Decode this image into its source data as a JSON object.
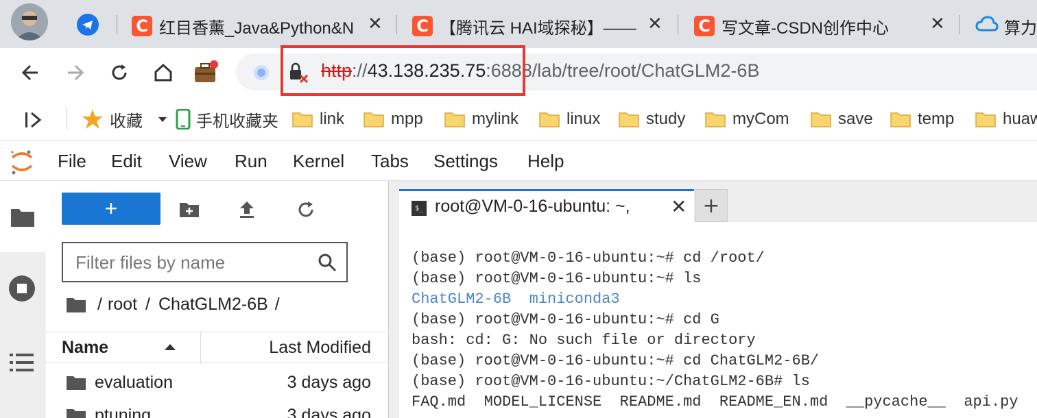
{
  "browser": {
    "tabs": [
      {
        "favicon": "C",
        "title": "红目香薰_Java&Python&N"
      },
      {
        "favicon": "C",
        "title": "【腾讯云 HAI域探秘】——"
      },
      {
        "favicon": "C",
        "title": "写文章-CSDN创作中心"
      },
      {
        "favicon": "cloud-icon",
        "title": "算力"
      }
    ],
    "tab_close_glyph": "✕",
    "url": {
      "scheme": "http",
      "separator": "://",
      "host": "43.138.235.75",
      "rest": ":6888/lab/tree/root/ChatGLM2-6B"
    },
    "bookmarks": [
      {
        "label": "收藏",
        "icon": "star-icon"
      },
      {
        "label": "手机收藏夹",
        "icon": "phone-icon"
      },
      {
        "label": "link",
        "icon": "folder-icon"
      },
      {
        "label": "mpp",
        "icon": "folder-icon"
      },
      {
        "label": "mylink",
        "icon": "folder-icon"
      },
      {
        "label": "linux",
        "icon": "folder-icon"
      },
      {
        "label": "study",
        "icon": "folder-icon"
      },
      {
        "label": "myCom",
        "icon": "folder-icon"
      },
      {
        "label": "save",
        "icon": "folder-icon"
      },
      {
        "label": "temp",
        "icon": "folder-icon"
      },
      {
        "label": "huaw",
        "icon": "folder-icon"
      }
    ]
  },
  "jupyter": {
    "menu": [
      "File",
      "Edit",
      "View",
      "Run",
      "Kernel",
      "Tabs",
      "Settings",
      "Help"
    ],
    "new_button": "+",
    "filter_placeholder": "Filter files by name",
    "breadcrumbs": [
      "/",
      "root",
      "/",
      "ChatGLM2-6B",
      "/"
    ],
    "columns": {
      "name": "Name",
      "modified": "Last Modified"
    },
    "files": [
      {
        "name": "evaluation",
        "modified": "3 days ago"
      },
      {
        "name": "ptuning",
        "modified": "3 days ago"
      }
    ],
    "terminal_tab": {
      "label": "root@VM-0-16-ubuntu: ~,",
      "close": "✕"
    },
    "add_tab": "+",
    "terminal_lines": [
      "(base) root@VM-0-16-ubuntu:~# cd /root/",
      "(base) root@VM-0-16-ubuntu:~# ls",
      "ChatGLM2-6B  miniconda3",
      "(base) root@VM-0-16-ubuntu:~# cd G",
      "bash: cd: G: No such file or directory",
      "(base) root@VM-0-16-ubuntu:~# cd ChatGLM2-6B/",
      "(base) root@VM-0-16-ubuntu:~/ChatGLM2-6B# ls",
      "FAQ.md  MODEL_LICENSE  README.md  README_EN.md  __pycache__  api.py  c"
    ],
    "colors": {
      "accent": "#1976d2",
      "csdn": "#fc5531",
      "highlight": "#e53935"
    }
  }
}
